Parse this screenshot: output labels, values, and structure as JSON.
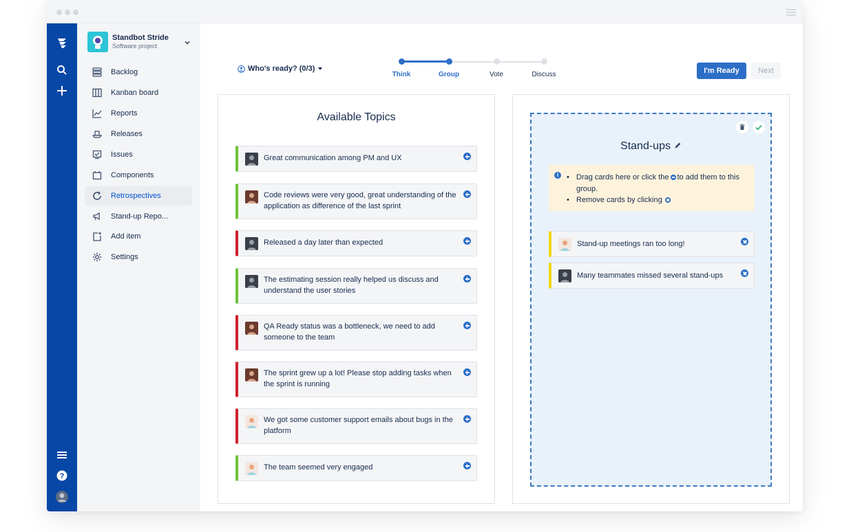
{
  "colors": {
    "global_nav": "#0747a6",
    "accent": "#2d6fc7",
    "positive": "#57d9a3",
    "good_border": "#6fc43a",
    "bad_border": "#d0202d",
    "group_border": "#f2d600"
  },
  "sidebar": {
    "project_name": "Standbot Stride",
    "project_type": "Software project",
    "items": [
      {
        "label": "Backlog",
        "icon": "backlog-icon"
      },
      {
        "label": "Kanban board",
        "icon": "board-icon"
      },
      {
        "label": "Reports",
        "icon": "chart-icon"
      },
      {
        "label": "Releases",
        "icon": "ship-icon"
      },
      {
        "label": "Issues",
        "icon": "issues-icon"
      },
      {
        "label": "Components",
        "icon": "components-icon"
      },
      {
        "label": "Retrospectives",
        "icon": "retro-icon",
        "active": true
      },
      {
        "label": "Stand-up Repo...",
        "icon": "megaphone-icon"
      },
      {
        "label": "Add item",
        "icon": "add-item-icon"
      },
      {
        "label": "Settings",
        "icon": "gear-icon"
      }
    ]
  },
  "toolbar": {
    "whos_ready": "Who's ready? (0/3)",
    "ready_button": "I'm Ready",
    "next_button": "Next"
  },
  "steps": [
    {
      "label": "Think",
      "done": true
    },
    {
      "label": "Group",
      "done": true
    },
    {
      "label": "Vote",
      "done": false
    },
    {
      "label": "Discuss",
      "done": false
    }
  ],
  "available": {
    "title": "Available Topics",
    "cards": [
      {
        "text": "Great communication among PM and UX",
        "sentiment": "good"
      },
      {
        "text": "Code reviews were very good, great understanding of the application as difference of the last sprint",
        "sentiment": "good"
      },
      {
        "text": "Released a day later than expected",
        "sentiment": "bad"
      },
      {
        "text": "The estimating session really helped us discuss and understand the user stories",
        "sentiment": "good"
      },
      {
        "text": "QA Ready status was a bottleneck, we need to add someone to the team",
        "sentiment": "bad"
      },
      {
        "text": "The sprint grew up a lot! Please stop adding tasks when the sprint is running",
        "sentiment": "bad"
      },
      {
        "text": "We got some customer support emails about bugs in the platform",
        "sentiment": "bad"
      },
      {
        "text": "The team seemed very engaged",
        "sentiment": "good"
      }
    ]
  },
  "group": {
    "title": "Stand-ups",
    "help_line1_a": "Drag cards here or click the",
    "help_line1_b": "to add them to this group.",
    "help_line2": "Remove cards by clicking",
    "cards": [
      {
        "text": "Stand-up meetings ran too long!"
      },
      {
        "text": "Many teammates missed several stand-ups"
      }
    ]
  }
}
